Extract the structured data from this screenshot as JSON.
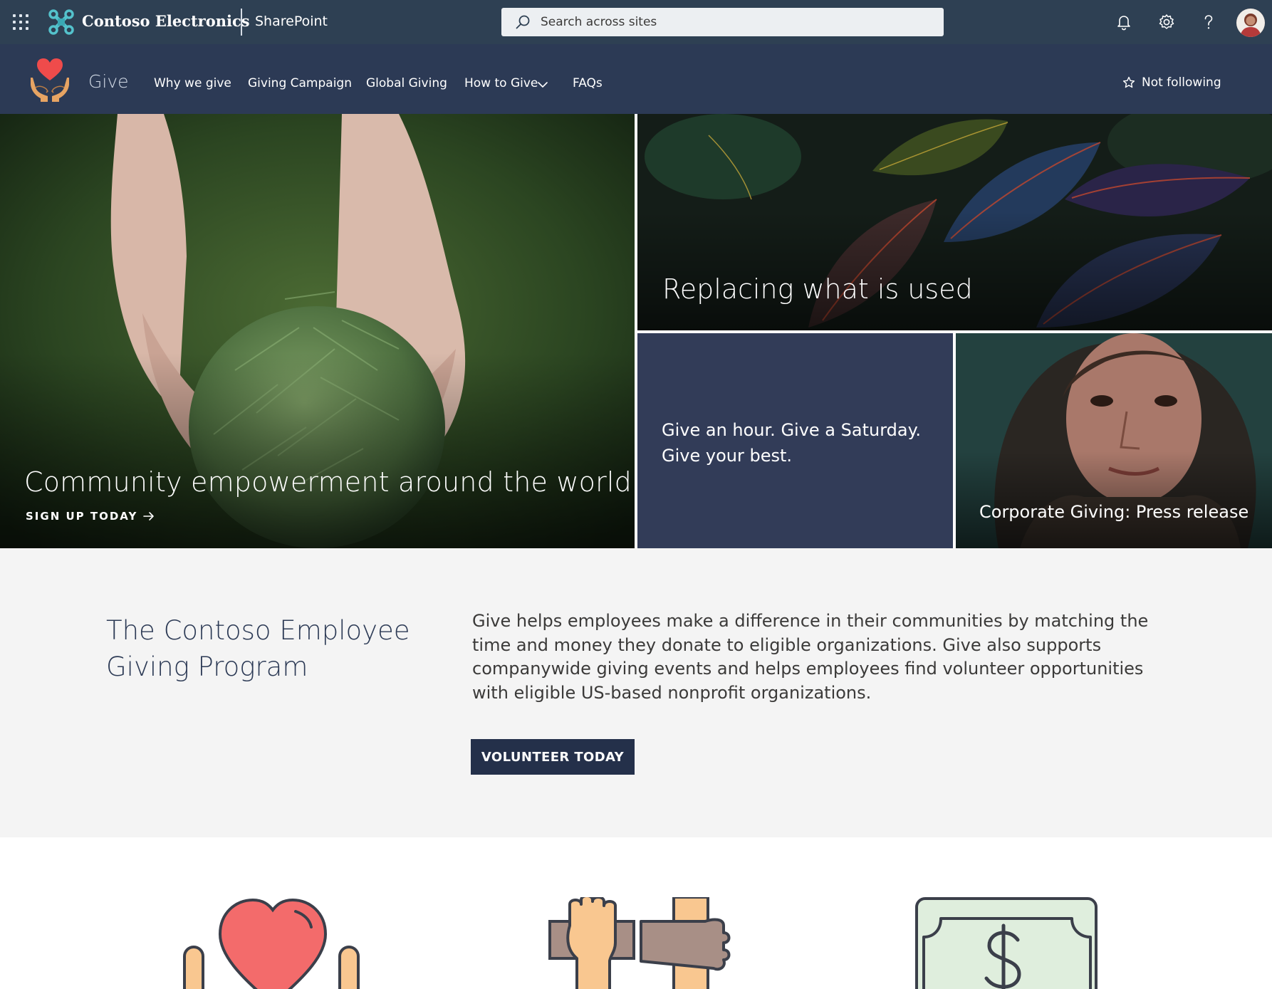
{
  "suite": {
    "company": "Contoso Electronics",
    "app": "SharePoint",
    "search_placeholder": "Search across sites",
    "icons": [
      "waffle-icon",
      "notification-bell-icon",
      "settings-gear-icon",
      "help-icon"
    ]
  },
  "site": {
    "title": "Give",
    "nav": [
      "Why we give",
      "Giving Campaign",
      "Global Giving",
      "How to Give",
      "FAQs"
    ],
    "follow_label": "Not following"
  },
  "hero": {
    "main_title": "Community empowerment around the world",
    "main_cta": "SIGN UP TODAY",
    "top_right_title": "Replacing what is used",
    "middle_text": "Give an hour. Give a Saturday. Give your best.",
    "bottom_right_title": "Corporate Giving: Press release"
  },
  "intro": {
    "heading": "The Contoso Employee Giving Program",
    "body": "Give helps employees make a difference in their communities by matching the time and money they donate to eligible organizations. Give also supports companywide giving events and helps employees find volunteer opportunities with eligible US-based nonprofit organizations.",
    "button": "VOLUNTEER TODAY"
  },
  "colors": {
    "suite_bar": "#2e4053",
    "site_header": "#2c3a55",
    "accent_navy": "#24304a",
    "heart_red": "#f26b6b"
  }
}
